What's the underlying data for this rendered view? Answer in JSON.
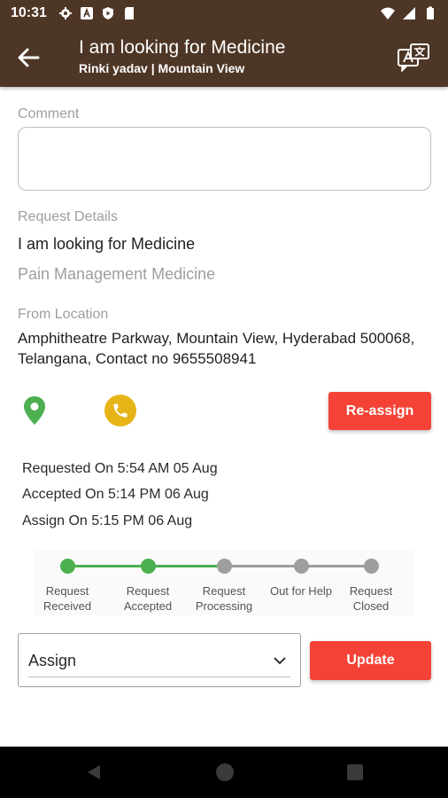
{
  "status_bar": {
    "time": "10:31",
    "left_icons": [
      "gear-icon",
      "a-badge-icon",
      "shield-icon",
      "sd-card-icon"
    ],
    "right_icons": [
      "wifi-icon",
      "signal-icon",
      "battery-icon"
    ]
  },
  "header": {
    "title": "I am looking for Medicine",
    "subtitle": "Rinki yadav | Mountain View",
    "back_icon": "arrow-back-icon",
    "translate_icon": "translate-icon"
  },
  "comment": {
    "label": "Comment",
    "value": ""
  },
  "request_details": {
    "label": "Request Details",
    "title": "I am looking for Medicine",
    "category": "Pain Management Medicine"
  },
  "location": {
    "label": "From Location",
    "address": "Amphitheatre Parkway, Mountain View, Hyderabad 500068, Telangana, Contact no 9655508941"
  },
  "actions": {
    "location_icon": "map-pin-icon",
    "call_icon": "phone-icon",
    "reassign_label": "Re-assign"
  },
  "history": [
    "Requested On 5:54 AM 05 Aug",
    "Accepted On 5:14 PM 06 Aug",
    "Assign On 5:15 PM 06 Aug"
  ],
  "tracker": {
    "completed_steps": 2,
    "active_color": "#4caf50",
    "inactive_color": "#9e9e9e",
    "steps": [
      {
        "line1": "Request",
        "line2": "Received"
      },
      {
        "line1": "Request",
        "line2": "Accepted"
      },
      {
        "line1": "Request",
        "line2": "Processing"
      },
      {
        "line1": "Out for Help",
        "line2": ""
      },
      {
        "line1": "Request",
        "line2": "Closed"
      }
    ]
  },
  "status_select": {
    "selected": "Assign"
  },
  "update_label": "Update",
  "colors": {
    "brand": "#4e3626",
    "accent_red": "#f44336",
    "call_yellow": "#e7b417",
    "pin_green": "#4caf50"
  }
}
